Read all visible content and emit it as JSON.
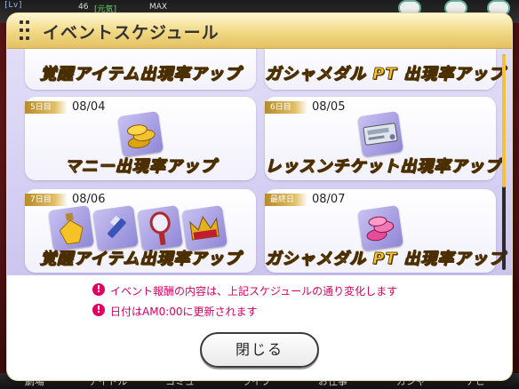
{
  "background": {
    "level_label": "[Lv]",
    "level_value": "46",
    "genki_label": "[元気]",
    "max_label": "MAX",
    "nav_items": [
      "劇場",
      "アイドル",
      "コミュ",
      "ライブ",
      "お仕事",
      "ガシャ",
      "ナビ"
    ]
  },
  "modal": {
    "title": "イベントスケジュール",
    "days": [
      {
        "effect": "覚醒アイテム出現率アップ"
      },
      {
        "effect": "ガシャメダル PT 出現率アップ"
      },
      {
        "badge": "5日目",
        "date": "08/04",
        "effect": "マニー出現率アップ",
        "items": [
          "money-coins-icon"
        ]
      },
      {
        "badge": "6日目",
        "date": "08/05",
        "effect": "レッスンチケット出現率アップ",
        "items": [
          "lesson-ticket-icon"
        ]
      },
      {
        "badge": "7日目",
        "date": "08/06",
        "effect": "覚醒アイテム出現率アップ",
        "items": [
          "perfume-icon",
          "lipstick-icon",
          "hand-mirror-icon",
          "crown-icon"
        ]
      },
      {
        "badge": "最終日",
        "date": "08/07",
        "effect": "ガシャメダル PT 出現率アップ",
        "items": [
          "gacha-medal-icon"
        ]
      }
    ],
    "notices": [
      "イベント報酬の内容は、上記スケジュールの通り変化します",
      "日付はAM0:00に更新されます"
    ],
    "close_label": "閉じる"
  },
  "colors": {
    "accent_gold": "#f7c629",
    "notice_pink": "#d8005f",
    "panel_lavender": "#ccc6ef"
  }
}
